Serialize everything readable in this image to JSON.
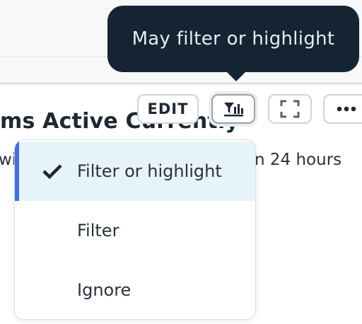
{
  "tooltip": {
    "text": "May filter or highlight"
  },
  "card": {
    "title": "ms Active Currently",
    "subtitle_left": "wi",
    "subtitle_right": "n 24 hours"
  },
  "toolbar": {
    "edit_label": "EDIT",
    "filter_icon": "filter-chart-icon",
    "fullscreen_icon": "fullscreen-icon",
    "more_icon": "more-horizontal-icon"
  },
  "menu": {
    "items": [
      {
        "label": "Filter or highlight",
        "selected": true
      },
      {
        "label": "Filter",
        "selected": false
      },
      {
        "label": "Ignore",
        "selected": false
      }
    ]
  },
  "colors": {
    "tooltip_bg": "#142433",
    "selected_bg": "#e6f3fb",
    "accent": "#3b6fe0"
  }
}
